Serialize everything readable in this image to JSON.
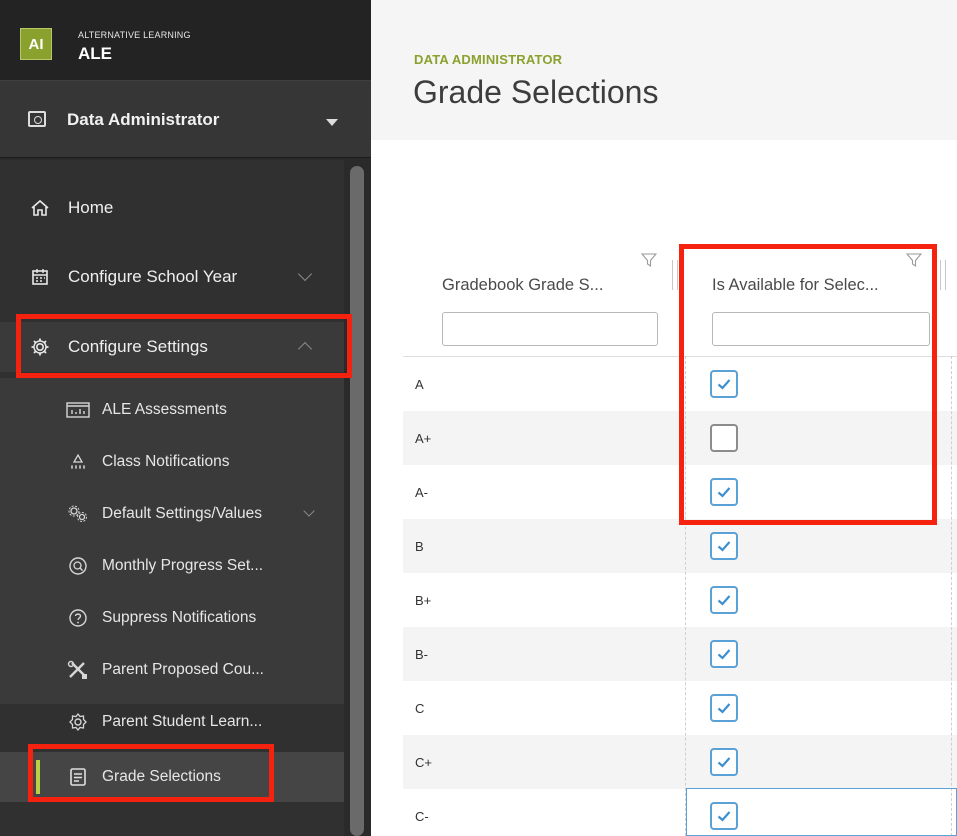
{
  "brand": {
    "logo": "AI",
    "small": "ALTERNATIVE LEARNING",
    "name": "ALE"
  },
  "role": {
    "label": "Data Administrator",
    "icon": "id-card-icon"
  },
  "nav": {
    "home": "Home",
    "configure_school_year": "Configure School Year",
    "configure_settings": "Configure Settings"
  },
  "sub": [
    {
      "label": "ALE Assessments",
      "icon": "chart-board-icon"
    },
    {
      "label": "Class Notifications",
      "icon": "notification-icon"
    },
    {
      "label": "Default Settings/Values",
      "icon": "gears-icon"
    },
    {
      "label": "Monthly Progress Set...",
      "icon": "progress-icon"
    },
    {
      "label": "Suppress Notifications",
      "icon": "question-circle-icon"
    },
    {
      "label": "Parent Proposed Cou...",
      "icon": "tools-icon"
    },
    {
      "label": "Parent Student Learn...",
      "icon": "settings-icon"
    },
    {
      "label": "Grade Selections",
      "icon": "list-icon"
    }
  ],
  "header": {
    "crumb": "DATA ADMINISTRATOR",
    "title": "Grade Selections"
  },
  "grid": {
    "col1": "Gradebook Grade S...",
    "col2": "Is Available for Selec...",
    "rows": [
      {
        "grade": "A",
        "available": true
      },
      {
        "grade": "A+",
        "available": false
      },
      {
        "grade": "A-",
        "available": true
      },
      {
        "grade": "B",
        "available": true
      },
      {
        "grade": "B+",
        "available": true
      },
      {
        "grade": "B-",
        "available": true
      },
      {
        "grade": "C",
        "available": true
      },
      {
        "grade": "C+",
        "available": true
      },
      {
        "grade": "C-",
        "available": true
      }
    ]
  },
  "colors": {
    "accent": "#8aa12e",
    "highlight": "#f5220f",
    "checkbox": "#5aa1d6"
  }
}
